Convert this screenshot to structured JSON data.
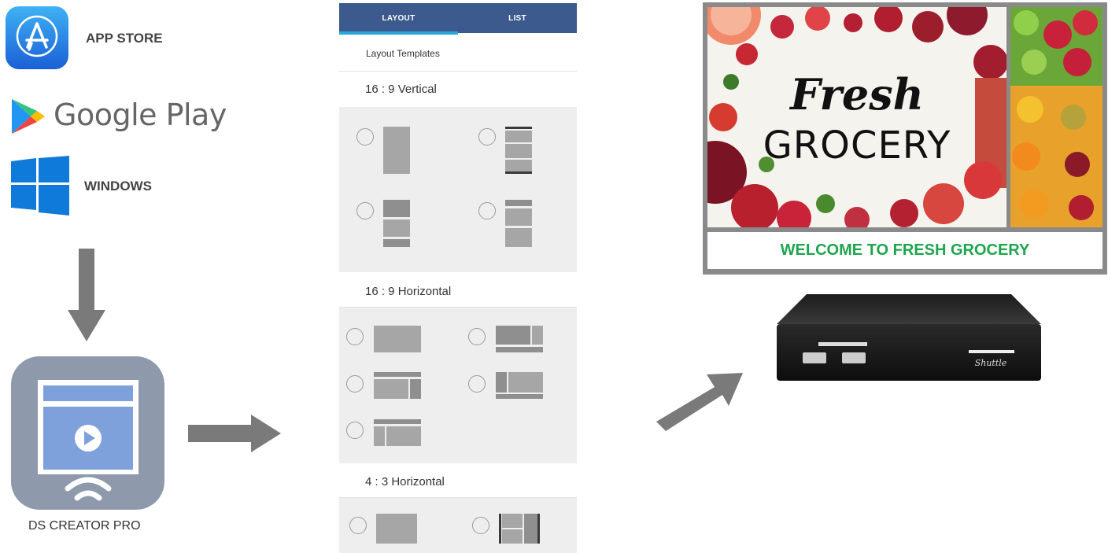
{
  "stores": {
    "app_store_label": "APP STORE",
    "google_play_label": "Google Play",
    "windows_label": "WINDOWS"
  },
  "app": {
    "name": "DS CREATOR PRO"
  },
  "phone": {
    "tabs": [
      {
        "label": "LAYOUT",
        "selected": true
      },
      {
        "label": "LIST",
        "selected": false
      }
    ],
    "subheader": "Layout Templates",
    "sections": [
      {
        "title": "16 : 9  Vertical",
        "template_count": 4
      },
      {
        "title": "16 : 9  Horizontal",
        "template_count": 5
      },
      {
        "title": "4 : 3  Horizontal",
        "template_count": 2
      }
    ]
  },
  "signage": {
    "logo_script": "Fresh",
    "logo_main": "GROCERY",
    "ticker": "WELCOME TO FRESH GROCERY"
  },
  "device": {
    "brand": "Shuttle"
  },
  "colors": {
    "tab_bar": "#3c5a8d",
    "tab_indicator": "#2aa7d9",
    "welcome_text": "#1ea54d",
    "arrow": "#7a7a7a",
    "app_icon_bg": "#8e9aab",
    "app_icon_screen": "#7ea1dc"
  },
  "icons": [
    "app-store-icon",
    "google-play-icon",
    "windows-icon",
    "ds-creator-icon",
    "play-icon",
    "wifi-icon"
  ]
}
